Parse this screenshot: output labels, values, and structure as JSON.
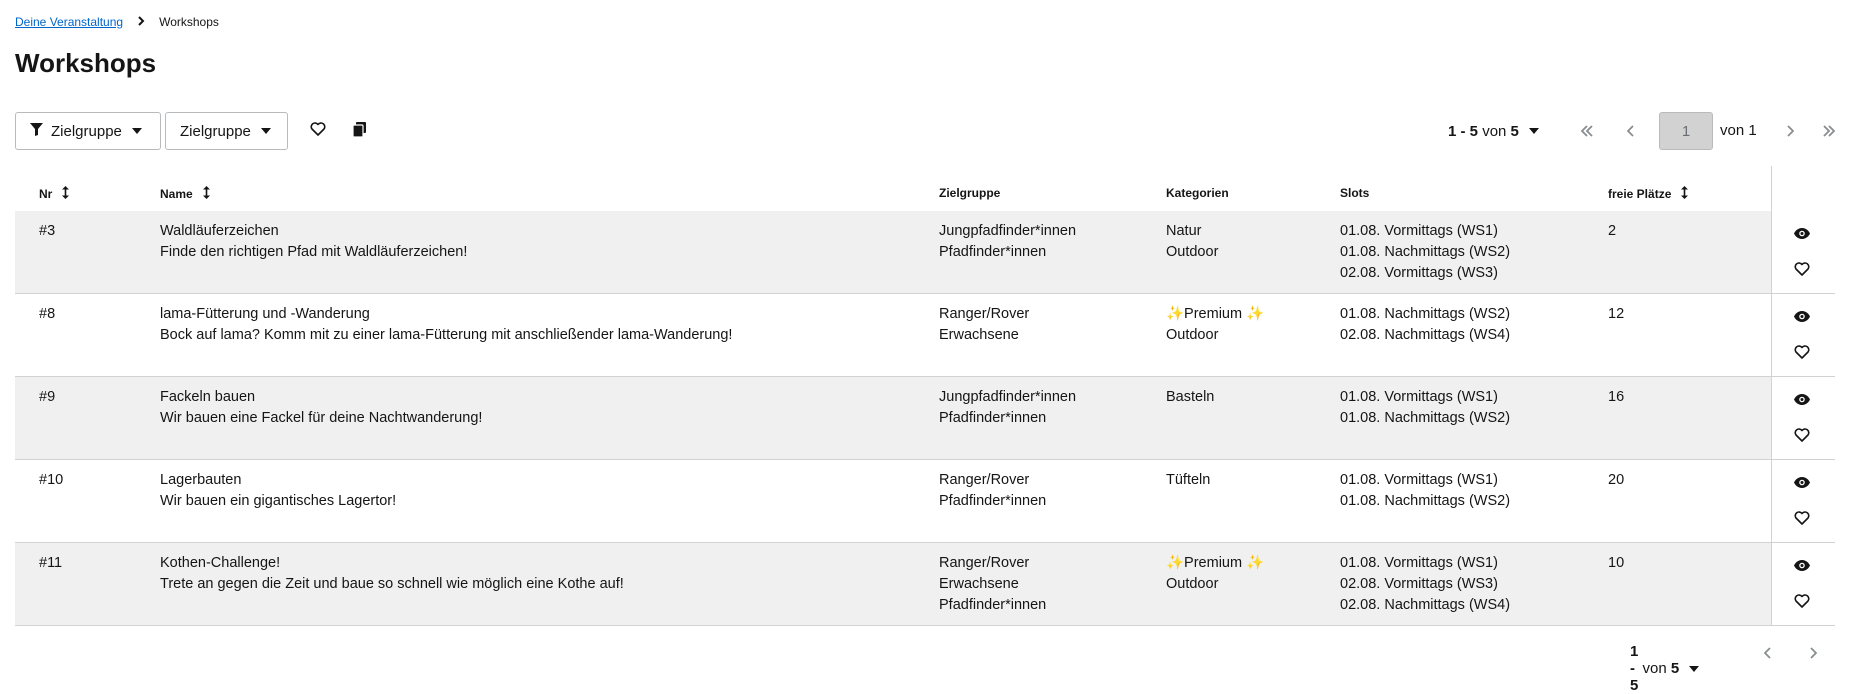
{
  "breadcrumb": {
    "parent": "Deine Veranstaltung",
    "current": "Workshops"
  },
  "page": {
    "title": "Workshops"
  },
  "toolbar": {
    "filter_attribute_label": "Zielgruppe",
    "filter_value_label": "Zielgruppe",
    "favorite_icon": "heart-outline-icon",
    "copy_icon": "copy-icon"
  },
  "pagination_top": {
    "range": "1 - 5",
    "von_word": "von",
    "total": "5",
    "current_page": "1",
    "of_pages": "von 1"
  },
  "table": {
    "columns": {
      "nr": "Nr",
      "name": "Name",
      "zielgruppe": "Zielgruppe",
      "kategorien": "Kategorien",
      "slots": "Slots",
      "freie_plaetze": "freie Plätze"
    },
    "rows": [
      {
        "nr": "#3",
        "title": "Waldläuferzeichen",
        "description": "Finde den richtigen Pfad mit Waldläuferzeichen!",
        "zielgruppe": [
          "Jungpfadfinder*innen",
          "Pfadfinder*innen"
        ],
        "kategorien": [
          "Natur",
          "Outdoor"
        ],
        "slots": [
          "01.08. Vormittags (WS1)",
          "01.08. Nachmittags (WS2)",
          "02.08. Vormittags (WS3)"
        ],
        "freie_plaetze": "2"
      },
      {
        "nr": "#8",
        "title": "lama-Fütterung und -Wanderung",
        "description": "Bock auf lama? Komm mit zu einer lama-Fütterung mit anschließender lama-Wanderung!",
        "zielgruppe": [
          "Ranger/Rover",
          "Erwachsene"
        ],
        "kategorien": [
          "✨Premium ✨",
          "Outdoor"
        ],
        "slots": [
          "01.08. Nachmittags (WS2)",
          "02.08. Nachmittags (WS4)"
        ],
        "freie_plaetze": "12"
      },
      {
        "nr": "#9",
        "title": "Fackeln bauen",
        "description": "Wir bauen eine Fackel für deine Nachtwanderung!",
        "zielgruppe": [
          "Jungpfadfinder*innen",
          "Pfadfinder*innen"
        ],
        "kategorien": [
          "Basteln"
        ],
        "slots": [
          "01.08. Vormittags (WS1)",
          "01.08. Nachmittags (WS2)"
        ],
        "freie_plaetze": "16"
      },
      {
        "nr": "#10",
        "title": "Lagerbauten",
        "description": "Wir bauen ein gigantisches Lagertor!",
        "zielgruppe": [
          "Ranger/Rover",
          "Pfadfinder*innen"
        ],
        "kategorien": [
          "Tüfteln"
        ],
        "slots": [
          "01.08. Vormittags (WS1)",
          "01.08. Nachmittags (WS2)"
        ],
        "freie_plaetze": "20"
      },
      {
        "nr": "#11",
        "title": "Kothen-Challenge!",
        "description": "Trete an gegen die Zeit und baue so schnell wie möglich eine Kothe auf!",
        "zielgruppe": [
          "Ranger/Rover",
          "Erwachsene",
          "Pfadfinder*innen"
        ],
        "kategorien": [
          "✨Premium ✨",
          "Outdoor"
        ],
        "slots": [
          "01.08. Vormittags (WS1)",
          "02.08. Vormittags (WS3)",
          "02.08. Nachmittags (WS4)"
        ],
        "freie_plaetze": "10"
      }
    ],
    "row_action_icons": [
      "eye-icon",
      "heart-outline-icon"
    ]
  },
  "pagination_bottom": {
    "range": "1 - 5",
    "von_word": "von",
    "total": "5"
  },
  "colors": {
    "link": "#0066cc",
    "row_shade": "#f0f0f0",
    "border": "#d2d2d2",
    "disabled": "#8a8d90"
  }
}
